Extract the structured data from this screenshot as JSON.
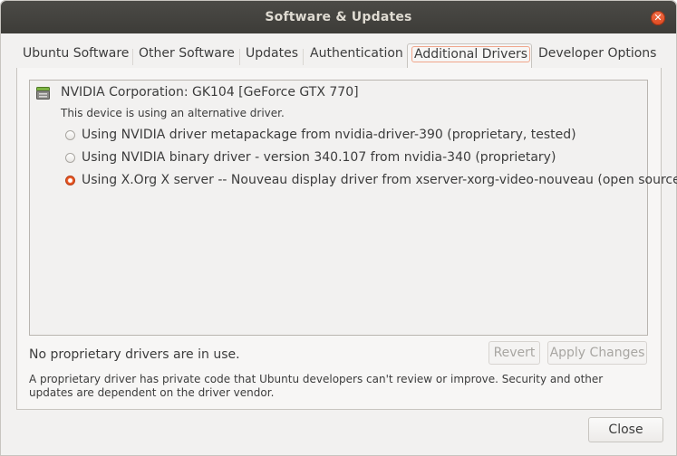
{
  "window": {
    "title": "Software & Updates",
    "close_glyph": "✕"
  },
  "tabs": [
    {
      "label": "Ubuntu Software",
      "active": false
    },
    {
      "label": "Other Software",
      "active": false
    },
    {
      "label": "Updates",
      "active": false
    },
    {
      "label": "Authentication",
      "active": false
    },
    {
      "label": "Additional Drivers",
      "active": true
    },
    {
      "label": "Developer Options",
      "active": false
    }
  ],
  "device": {
    "icon": "graphics-card-icon",
    "name": "NVIDIA Corporation: GK104 [GeForce GTX 770]",
    "status": "This device is using an alternative driver.",
    "options": [
      {
        "label": "Using NVIDIA driver metapackage from nvidia-driver-390 (proprietary, tested)",
        "selected": false
      },
      {
        "label": "Using NVIDIA binary driver - version 340.107 from nvidia-340 (proprietary)",
        "selected": false
      },
      {
        "label": "Using X.Org X server -- Nouveau display driver from xserver-xorg-video-nouveau (open source)",
        "selected": true
      }
    ]
  },
  "footer": {
    "status": "No proprietary drivers are in use.",
    "revert_label": "Revert",
    "apply_label": "Apply Changes",
    "note": "A proprietary driver has private code that Ubuntu developers can't review or improve. Security and other updates are dependent on the driver vendor."
  },
  "close_label": "Close",
  "colors": {
    "accent": "#e95420",
    "titlebar": "#3d3c38",
    "window_bg": "#f2f1f0"
  }
}
